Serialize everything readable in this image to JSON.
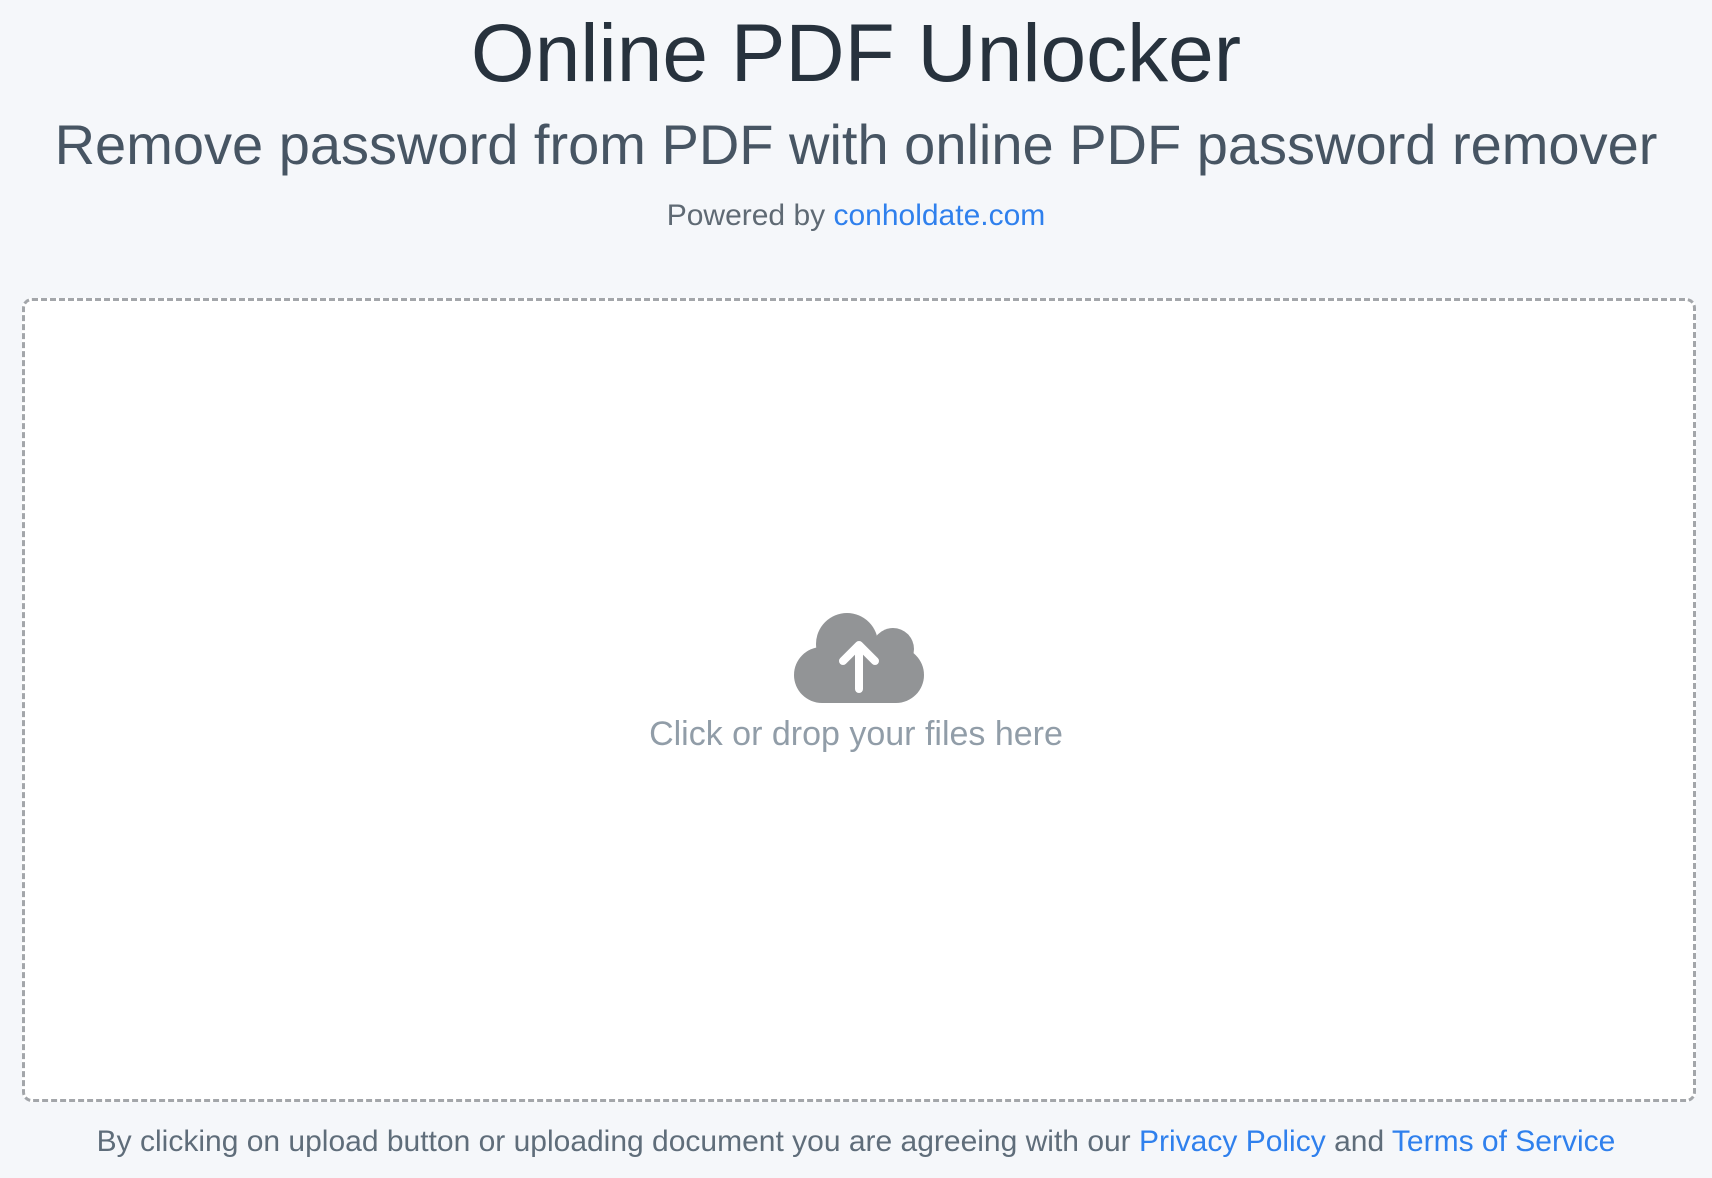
{
  "header": {
    "title": "Online PDF Unlocker",
    "subtitle": "Remove password from PDF with online PDF password remover",
    "powered_prefix": "Powered by ",
    "powered_link": "conholdate.com"
  },
  "dropzone": {
    "icon": "cloud-upload-icon",
    "label": "Click or drop your files here"
  },
  "footer": {
    "text": "By clicking on upload button or uploading document you are agreeing with our ",
    "privacy_link": "Privacy Policy",
    "and_text": " and ",
    "terms_link": "Terms of Service"
  },
  "colors": {
    "background": "#f5f7fa",
    "link": "#2f80ed",
    "icon": "#929496",
    "title": "#27323d"
  }
}
